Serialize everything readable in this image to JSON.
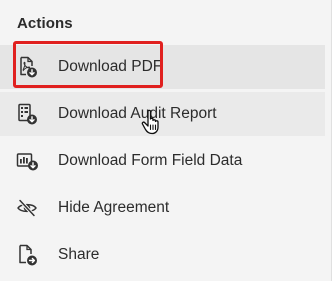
{
  "panel": {
    "title": "Actions",
    "items": [
      {
        "label": "Download PDF",
        "icon": "download-pdf-icon"
      },
      {
        "label": "Download Audit Report",
        "icon": "download-audit-report-icon"
      },
      {
        "label": "Download Form Field Data",
        "icon": "download-form-data-icon"
      },
      {
        "label": "Hide Agreement",
        "icon": "hide-eye-icon"
      },
      {
        "label": "Share",
        "icon": "share-icon"
      }
    ]
  },
  "colors": {
    "highlight": "#e0201f",
    "text": "#2c2c2c",
    "background": "#f4f4f4"
  }
}
